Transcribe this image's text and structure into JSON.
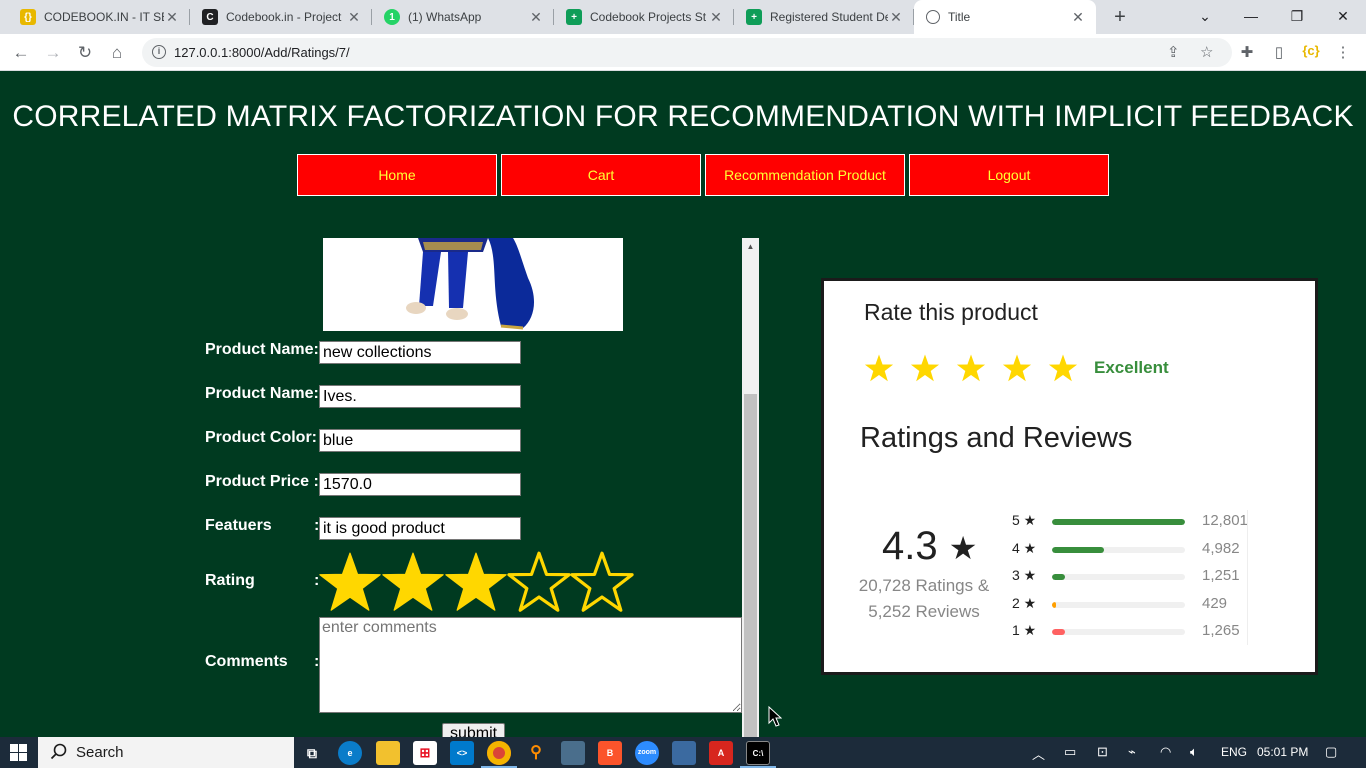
{
  "browser": {
    "tabs": [
      {
        "title": "CODEBOOK.IN - IT SE",
        "favicon": "codebook-favicon",
        "color": "#e8b800"
      },
      {
        "title": "Codebook.in - Project",
        "favicon": "codebook-dark-favicon",
        "color": "#202124"
      },
      {
        "title": "(1) WhatsApp",
        "favicon": "whatsapp-favicon",
        "color": "#25d366"
      },
      {
        "title": "Codebook Projects St",
        "favicon": "sheets-favicon",
        "color": "#0f9d58"
      },
      {
        "title": "Registered Student De",
        "favicon": "sheets-favicon",
        "color": "#0f9d58"
      },
      {
        "title": "Title",
        "favicon": "globe-favicon",
        "color": "#5f6368",
        "active": true
      }
    ],
    "url": "127.0.0.1:8000/Add/Ratings/7/"
  },
  "page": {
    "title": "CORRELATED MATRIX FACTORIZATION FOR RECOMMENDATION WITH IMPLICIT FEEDBACK",
    "nav": [
      "Home",
      "Cart",
      "Recommendation Product",
      "Logout"
    ],
    "colors": {
      "background": "#003a20",
      "nav_bg": "#ff0000",
      "nav_text": "#ffff33",
      "star": "#ffd700"
    }
  },
  "form": {
    "fields": [
      {
        "label": "Product Name:",
        "value": "new collections"
      },
      {
        "label": "Product Name:",
        "value": "Ives."
      },
      {
        "label": "Product Color:",
        "value": "blue"
      },
      {
        "label": "Product Price :",
        "value": "1570.0"
      },
      {
        "label": "Featuers",
        "value": "it is good product"
      }
    ],
    "rating_label": "Rating",
    "rating_value": 3,
    "rating_max": 5,
    "comments_label": "Comments",
    "comments_placeholder": "enter comments",
    "colon": ":",
    "submit": "submit"
  },
  "rating_card": {
    "title": "Rate this product",
    "stars_shown": 5,
    "excellent": "Excellent",
    "reviews_heading": "Ratings and Reviews",
    "average": "4.3",
    "star_glyph": "★",
    "ratings_count_line": "20,728 Ratings &",
    "reviews_count_line": "5,252 Reviews",
    "breakdown": [
      {
        "stars": "5",
        "count": "12,801",
        "fill": 1.0,
        "color": "#388e3c"
      },
      {
        "stars": "4",
        "count": "4,982",
        "fill": 0.39,
        "color": "#388e3c"
      },
      {
        "stars": "3",
        "count": "1,251",
        "fill": 0.1,
        "color": "#388e3c"
      },
      {
        "stars": "2",
        "count": "429",
        "fill": 0.03,
        "color": "#ff9f00"
      },
      {
        "stars": "1",
        "count": "1,265",
        "fill": 0.1,
        "color": "#ff6161"
      }
    ]
  },
  "taskbar": {
    "search_text": "Search",
    "language": "ENG",
    "time": "05:01 PM"
  }
}
